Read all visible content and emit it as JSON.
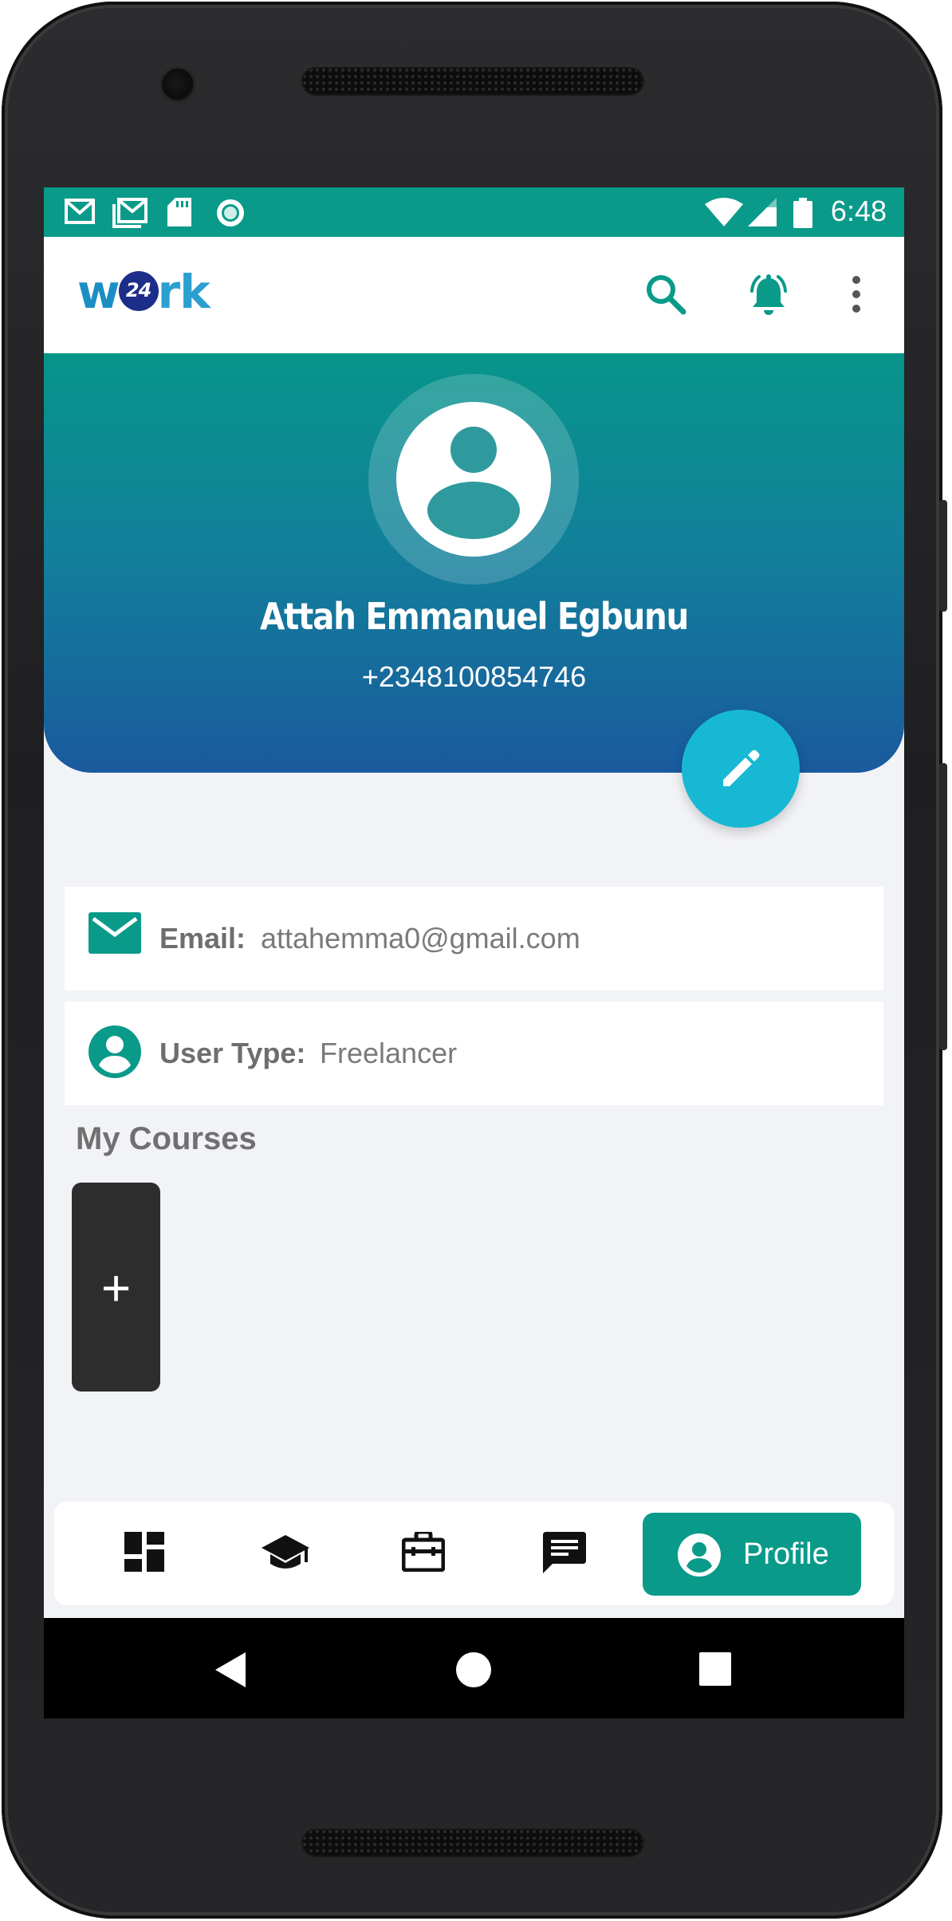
{
  "status_bar": {
    "time": "6:48",
    "left_icons": [
      "gmail-icon",
      "gmail-outline-icon",
      "sd-card-icon",
      "record-icon"
    ],
    "right_icons": [
      "wifi-icon",
      "signal-icon",
      "battery-icon"
    ]
  },
  "app_bar": {
    "logo_prefix": "w",
    "logo_badge": "24",
    "logo_suffix": "rk",
    "actions": [
      "search-icon",
      "bell-icon",
      "more-vertical-icon"
    ]
  },
  "profile": {
    "name": "Attah Emmanuel Egbunu",
    "phone": "+2348100854746",
    "edit_icon": "pencil-icon"
  },
  "details": {
    "email_label": "Email:",
    "email_value": "attahemma0@gmail.com",
    "user_type_label": "User Type:",
    "user_type_value": "Freelancer"
  },
  "courses": {
    "title": "My Courses",
    "add_label": "+"
  },
  "bottom_nav": {
    "items": [
      "dashboard-icon",
      "school-icon",
      "briefcase-icon",
      "chat-icon"
    ],
    "active_label": "Profile",
    "active_icon": "account-circle-icon"
  },
  "system_nav": [
    "back-icon",
    "home-icon",
    "recents-icon"
  ],
  "colors": {
    "primary": "#0a9a8a",
    "header_gradient_top": "#07958a",
    "header_gradient_bottom": "#1a5a9e",
    "fab": "#16b8d3",
    "background": "#f2f3f7"
  }
}
